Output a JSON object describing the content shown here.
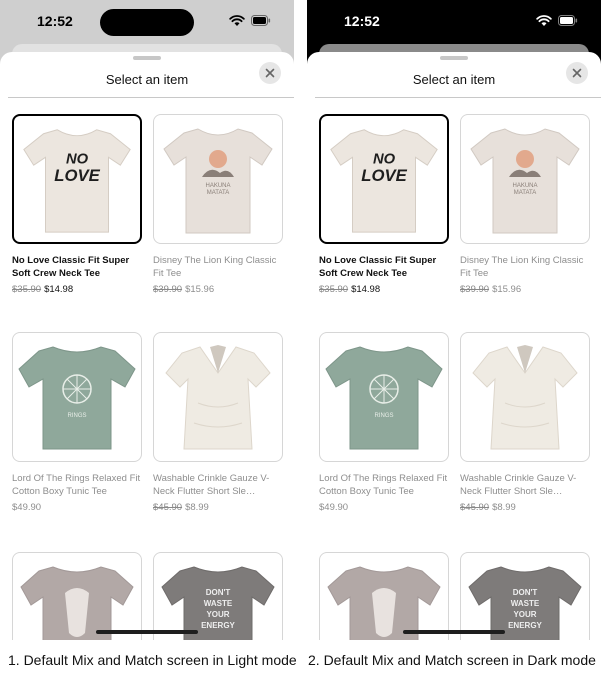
{
  "screens": [
    {
      "mode": "light",
      "status_time": "12:52",
      "sheet_title": "Select an item",
      "caption": "1. Default Mix and Match screen in Light mode"
    },
    {
      "mode": "dark",
      "status_time": "12:52",
      "sheet_title": "Select an item",
      "caption": "2. Default Mix and Match screen in Dark mode"
    }
  ],
  "products": [
    {
      "name": "No Love Classic Fit Super Soft Crew Neck Tee",
      "original_price": "$35.90",
      "price": "$14.98",
      "selected": true,
      "shirt_color": "#ece6df",
      "print_text": "NO LOVE"
    },
    {
      "name": "Disney The Lion King Classic Fit Tee",
      "original_price": "$39.90",
      "price": "$15.96",
      "selected": false,
      "shirt_color": "#e7e0da",
      "print_text": "HAKUNA MATATA"
    },
    {
      "name": "Lord Of The Rings Relaxed Fit Cotton Boxy Tunic Tee",
      "original_price": "",
      "price": "$49.90",
      "selected": false,
      "shirt_color": "#8fa89b",
      "print_text": "RINGS"
    },
    {
      "name": "Washable Crinkle Gauze V-Neck Flutter Short Sle…",
      "original_price": "$45.90",
      "price": "$8.99",
      "selected": false,
      "shirt_color": "#efebe3",
      "print_text": ""
    },
    {
      "name": "",
      "original_price": "",
      "price": "",
      "selected": false,
      "shirt_color": "#b2a8a6",
      "print_text": ""
    },
    {
      "name": "",
      "original_price": "",
      "price": "",
      "selected": false,
      "shirt_color": "#7e7b7a",
      "print_text": "DON'T WASTE YOUR ENERGY"
    }
  ],
  "icons": {
    "wifi": "wifi-icon",
    "battery": "battery-icon",
    "close": "close-icon"
  }
}
